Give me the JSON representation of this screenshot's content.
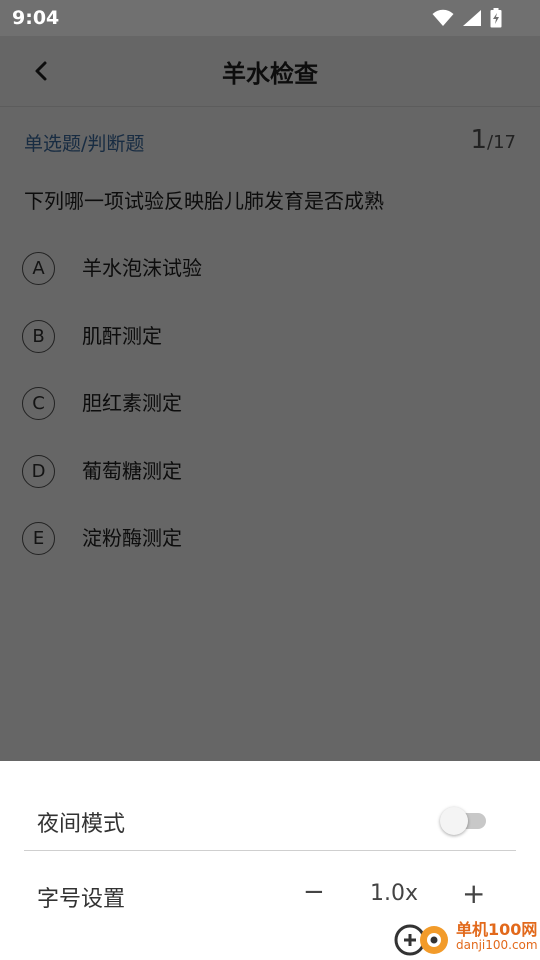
{
  "status_bar": {
    "time": "9:04"
  },
  "header": {
    "title": "羊水检查"
  },
  "question": {
    "type_label": "单选题/判断题",
    "current": "1",
    "total": "/17",
    "text": "下列哪一项试验反映胎儿肺发育是否成熟",
    "options": [
      {
        "letter": "A",
        "text": "羊水泡沫试验"
      },
      {
        "letter": "B",
        "text": "肌酐测定"
      },
      {
        "letter": "C",
        "text": "胆红素测定"
      },
      {
        "letter": "D",
        "text": "葡萄糖测定"
      },
      {
        "letter": "E",
        "text": "淀粉酶测定"
      }
    ]
  },
  "settings_sheet": {
    "night_mode_label": "夜间模式",
    "night_mode_on": false,
    "font_size_label": "字号设置",
    "minus_label": "−",
    "font_scale": "1.0x",
    "plus_label": "+"
  },
  "watermark": {
    "title": "单机100网",
    "url": "danji100.com"
  }
}
